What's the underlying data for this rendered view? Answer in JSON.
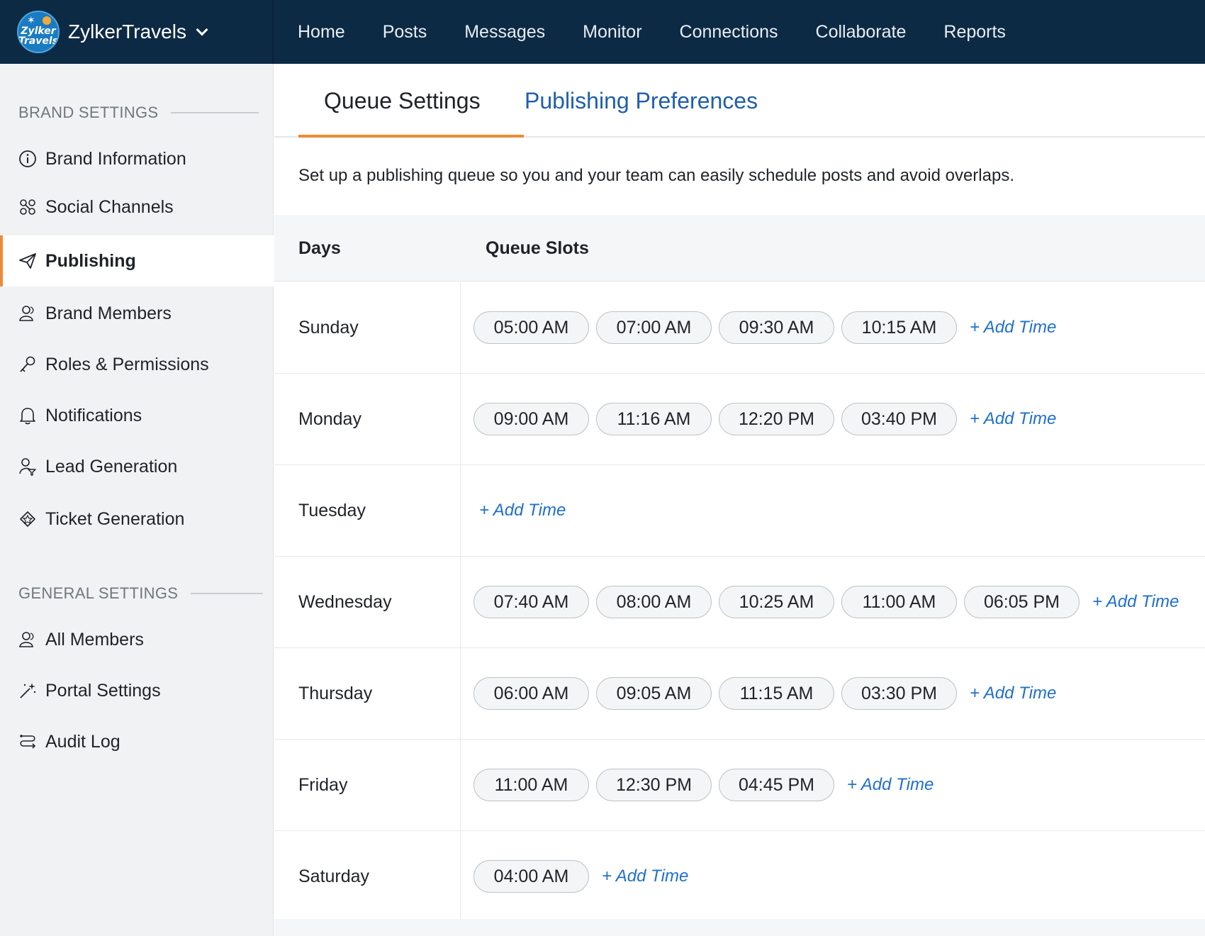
{
  "app": {
    "brand_name": "ZylkerTravels",
    "logo_text": [
      "Zylker",
      "Travels"
    ],
    "accent_color": "#ef8a37",
    "topbar_color": "#0d2a44"
  },
  "nav": [
    "Home",
    "Posts",
    "Messages",
    "Monitor",
    "Connections",
    "Collaborate",
    "Reports"
  ],
  "sidebar": {
    "brand_section_title": "BRAND SETTINGS",
    "brand_items": [
      {
        "label": "Brand Information",
        "icon": "info-icon"
      },
      {
        "label": "Social Channels",
        "icon": "social-channels-icon"
      },
      {
        "label": "Publishing",
        "icon": "paper-plane-icon",
        "active": true
      },
      {
        "label": "Brand Members",
        "icon": "members-icon"
      },
      {
        "label": "Roles & Permissions",
        "icon": "key-icon"
      },
      {
        "label": "Notifications",
        "icon": "bell-icon"
      },
      {
        "label": "Lead Generation",
        "icon": "lead-icon"
      },
      {
        "label": "Ticket Generation",
        "icon": "ticket-icon"
      }
    ],
    "general_section_title": "GENERAL SETTINGS",
    "general_items": [
      {
        "label": "All Members",
        "icon": "members-icon"
      },
      {
        "label": "Portal Settings",
        "icon": "magic-wand-icon"
      },
      {
        "label": "Audit Log",
        "icon": "audit-log-icon"
      }
    ]
  },
  "tabs": {
    "queue": "Queue Settings",
    "publishing": "Publishing Preferences"
  },
  "description": "Set up a publishing queue so you and your team can easily schedule posts and avoid overlaps.",
  "table": {
    "header_days": "Days",
    "header_slots": "Queue Slots",
    "add_label": "+ Add Time",
    "rows": [
      {
        "day": "Sunday",
        "slots": [
          "05:00 AM",
          "07:00 AM",
          "09:30 AM",
          "10:15 AM"
        ]
      },
      {
        "day": "Monday",
        "slots": [
          "09:00 AM",
          "11:16 AM",
          "12:20 PM",
          "03:40 PM"
        ]
      },
      {
        "day": "Tuesday",
        "slots": []
      },
      {
        "day": "Wednesday",
        "slots": [
          "07:40 AM",
          "08:00 AM",
          "10:25 AM",
          "11:00 AM",
          "06:05 PM"
        ]
      },
      {
        "day": "Thursday",
        "slots": [
          "06:00 AM",
          "09:05 AM",
          "11:15 AM",
          "03:30 PM"
        ]
      },
      {
        "day": "Friday",
        "slots": [
          "11:00 AM",
          "12:30 PM",
          "04:45 PM"
        ]
      },
      {
        "day": "Saturday",
        "slots": [
          "04:00 AM"
        ]
      }
    ]
  }
}
